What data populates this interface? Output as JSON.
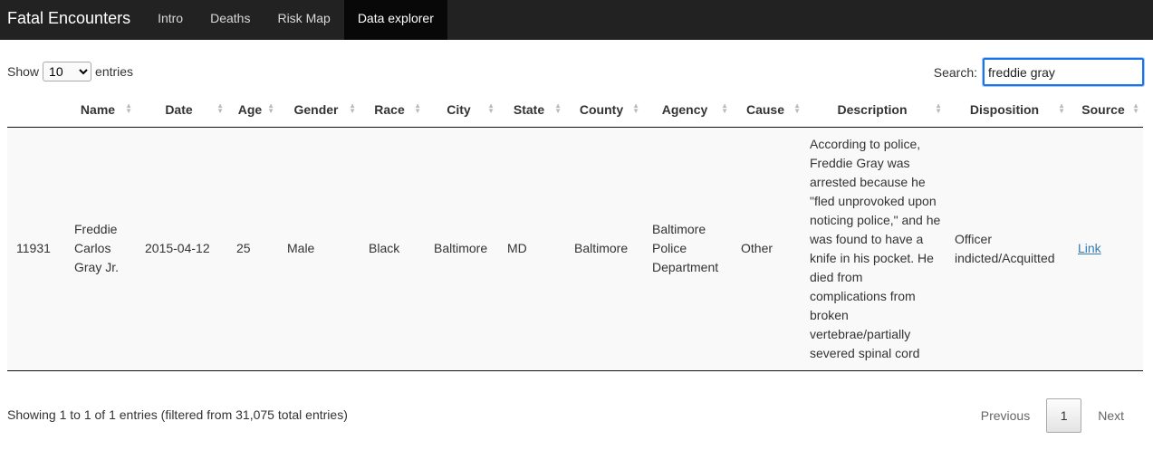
{
  "navbar": {
    "brand": "Fatal Encounters",
    "items": [
      {
        "label": "Intro",
        "active": false
      },
      {
        "label": "Deaths",
        "active": false
      },
      {
        "label": "Risk Map",
        "active": false
      },
      {
        "label": "Data explorer",
        "active": true
      }
    ]
  },
  "length_control": {
    "prefix": "Show",
    "selected": "10",
    "suffix": "entries"
  },
  "search": {
    "label": "Search:",
    "value": "freddie gray"
  },
  "table": {
    "columns": [
      "",
      "Name",
      "Date",
      "Age",
      "Gender",
      "Race",
      "City",
      "State",
      "County",
      "Agency",
      "Cause",
      "Description",
      "Disposition",
      "Source"
    ],
    "rows": [
      {
        "id": "11931",
        "name": "Freddie Carlos Gray Jr.",
        "date": "2015-04-12",
        "age": "25",
        "gender": "Male",
        "race": "Black",
        "city": "Baltimore",
        "state": "MD",
        "county": "Baltimore",
        "agency": "Baltimore Police Department",
        "cause": "Other",
        "description": "According to police, Freddie Gray was arrested because he \"fled unprovoked upon noticing police,\" and he was found to have a knife in his pocket. He died from complications from broken vertebrae/partially severed spinal cord",
        "disposition": "Officer indicted/Acquitted",
        "source": "Link"
      }
    ]
  },
  "info": "Showing 1 to 1 of 1 entries (filtered from 31,075 total entries)",
  "pagination": {
    "previous": "Previous",
    "current": "1",
    "next": "Next"
  },
  "colors": {
    "navbar_bg": "#222222",
    "navbar_active_bg": "#080808",
    "link": "#337ab7",
    "focus": "#1a73e8"
  }
}
